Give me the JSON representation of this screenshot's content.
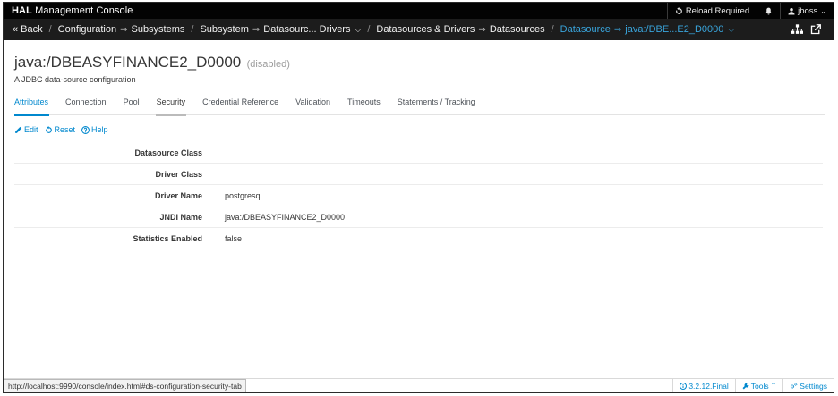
{
  "topbar": {
    "brand_bold": "HAL",
    "brand_rest": "Management Console",
    "reload": "Reload Required",
    "user": "jboss"
  },
  "navbar": {
    "back": "Back",
    "crumbs": [
      "Configuration",
      "Subsystems",
      "Subsystem",
      "Datasourc... Drivers",
      "Datasources & Drivers",
      "Datasources",
      "Datasource",
      "java:/DBE...E2_D0000"
    ]
  },
  "header": {
    "title": "java:/DBEASYFINANCE2_D0000",
    "status": "(disabled)",
    "description": "A JDBC data-source configuration"
  },
  "tabs": [
    "Attributes",
    "Connection",
    "Pool",
    "Security",
    "Credential Reference",
    "Validation",
    "Timeouts",
    "Statements / Tracking"
  ],
  "actions": {
    "edit": "Edit",
    "reset": "Reset",
    "help": "Help"
  },
  "attributes": [
    {
      "label": "Datasource Class",
      "value": ""
    },
    {
      "label": "Driver Class",
      "value": ""
    },
    {
      "label": "Driver Name",
      "value": "postgresql"
    },
    {
      "label": "JNDI Name",
      "value": "java:/DBEASYFINANCE2_D0000"
    },
    {
      "label": "Statistics Enabled",
      "value": "false"
    }
  ],
  "statusbar": {
    "url": "http://localhost:9990/console/index.html#ds-configuration-security-tab",
    "version": "3.2.12.Final",
    "tools": "Tools",
    "settings": "Settings"
  },
  "colors": {
    "accent": "#0088ce",
    "active_crumb": "#39a5dc",
    "topbar": "#030303",
    "navbar": "#1c1c1c"
  }
}
